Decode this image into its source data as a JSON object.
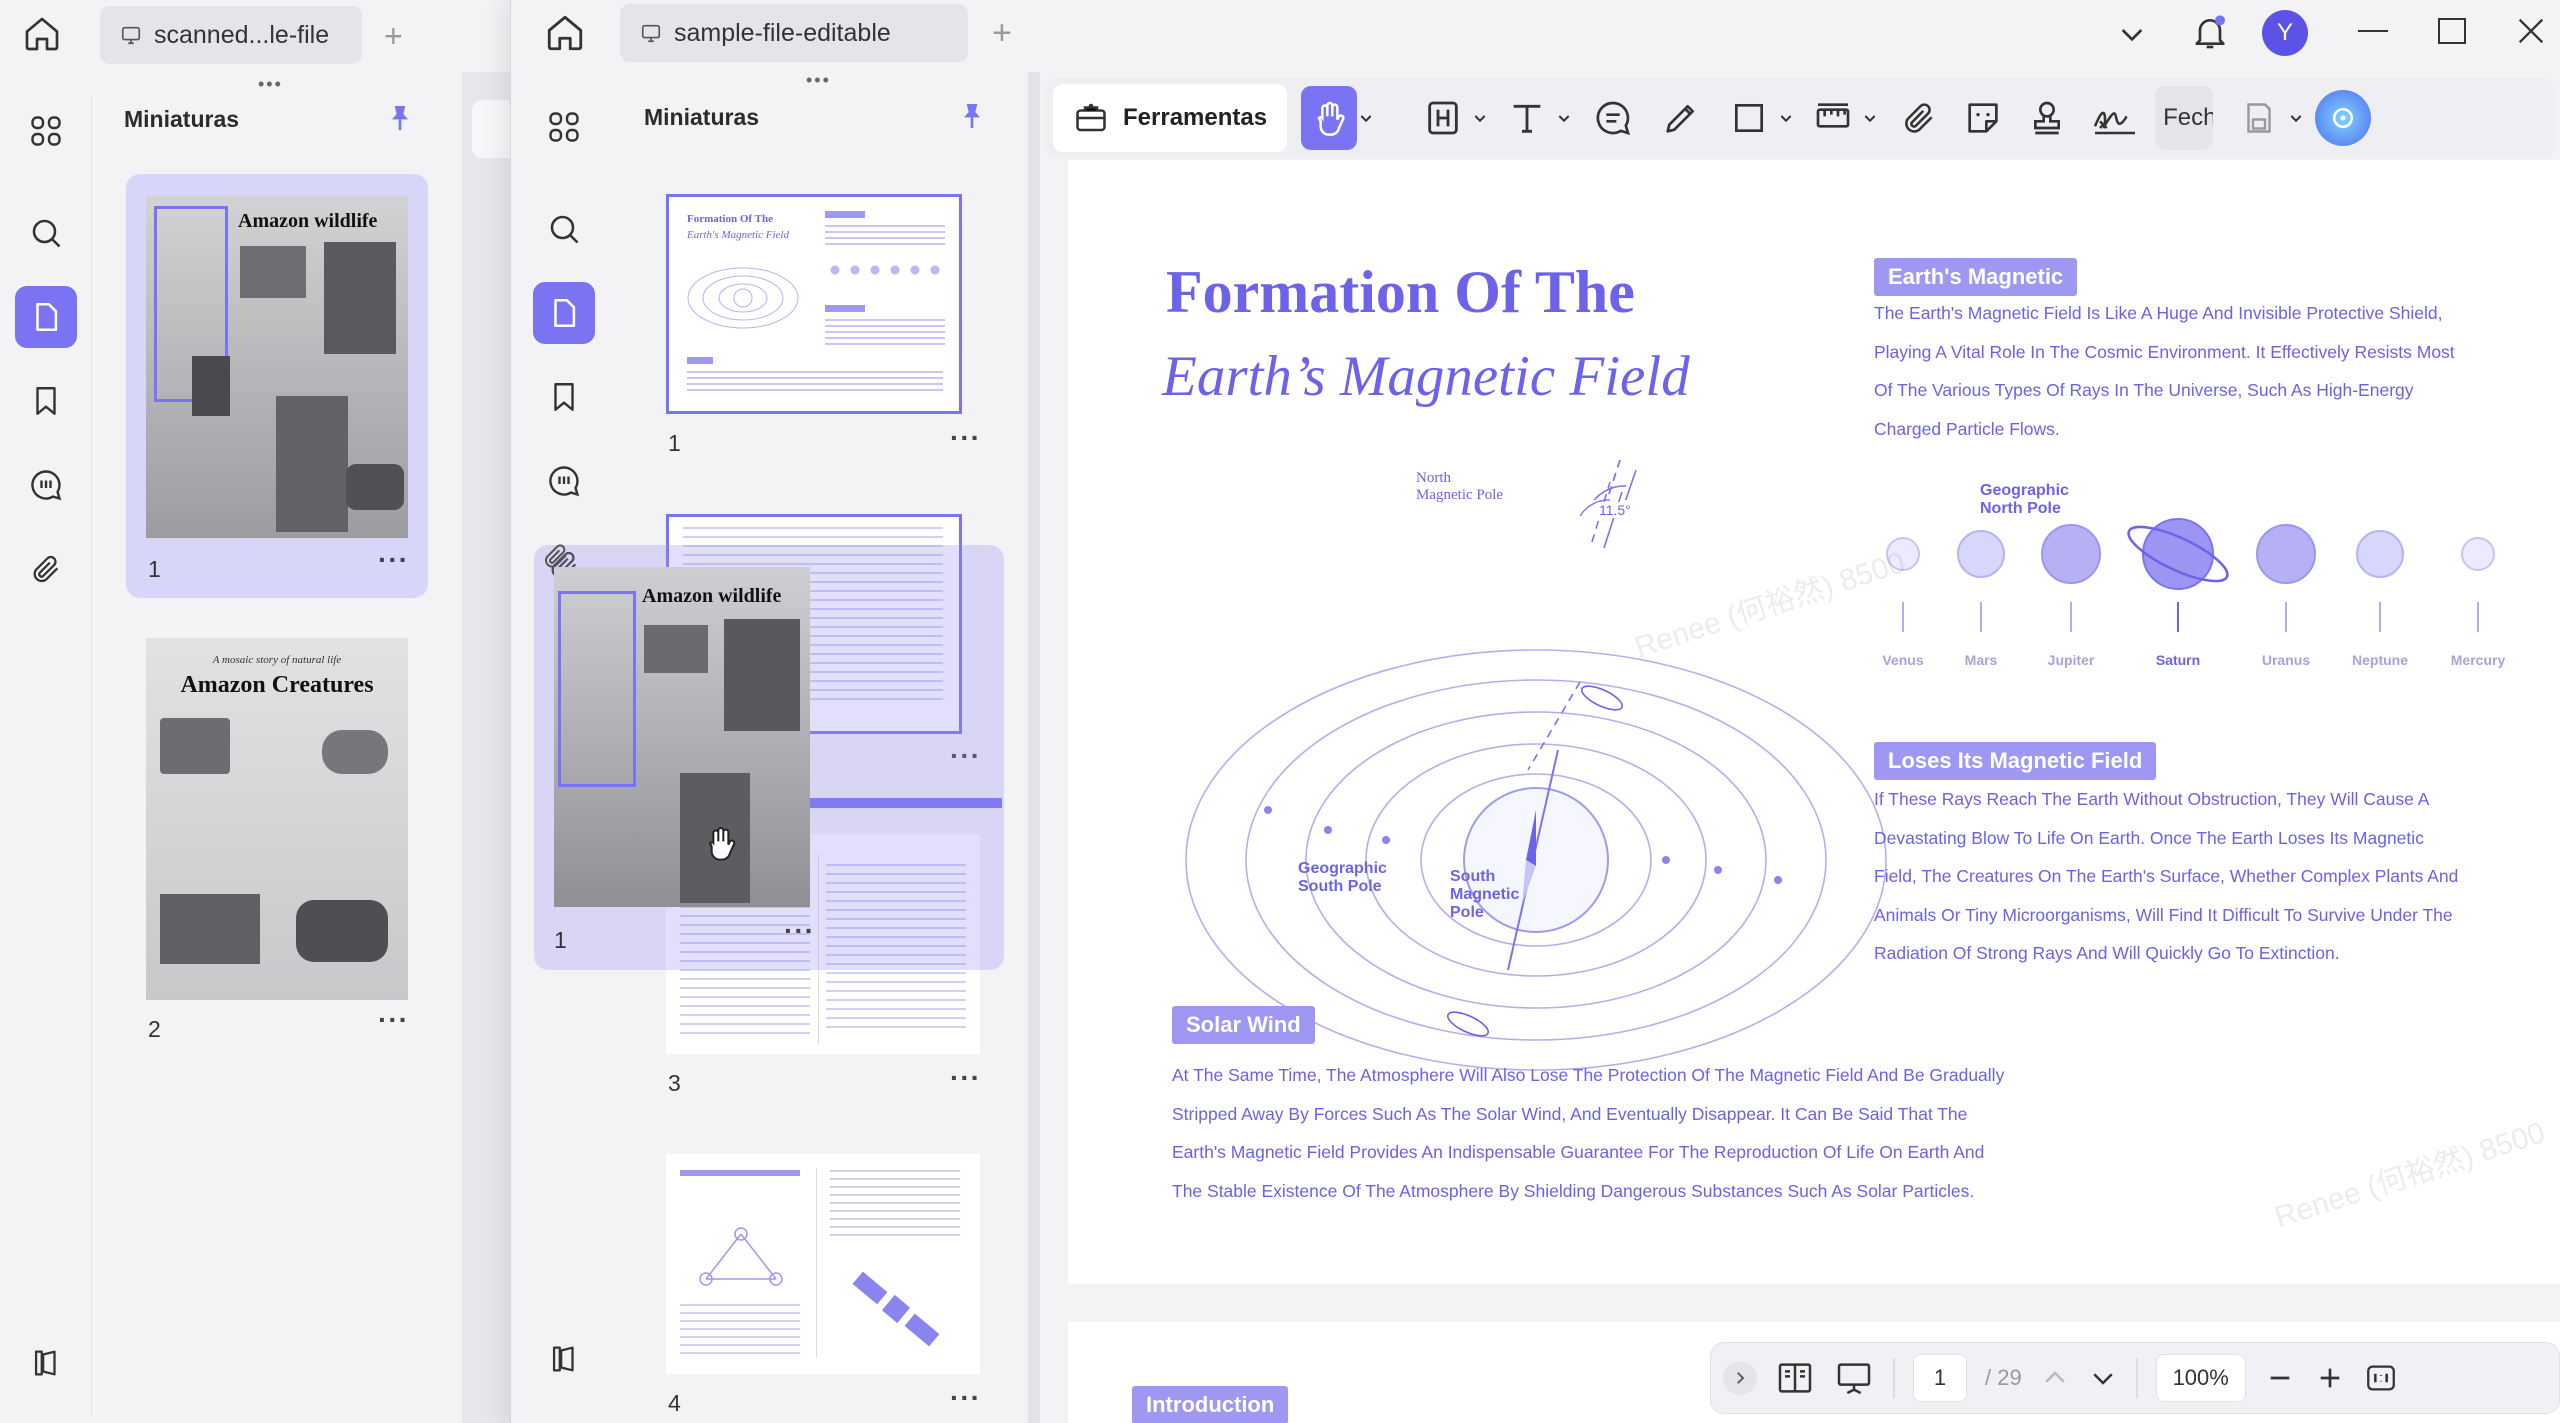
{
  "back_window": {
    "tab_title": "scanned...le-file",
    "panel_title": "Miniaturas",
    "thumbnails": [
      {
        "page": "1",
        "heading": "Amazon wildlife"
      },
      {
        "page": "2",
        "heading": "Amazon Creatures",
        "kicker": "A mosaic story of natural life"
      }
    ]
  },
  "front_window": {
    "tab_title": "sample-file-editable",
    "panel_title": "Miniaturas",
    "avatar_letter": "Y",
    "thumbnails": [
      {
        "page": "1",
        "title_line1": "Formation Of The",
        "title_line2": "Earth's Magnetic Field"
      },
      {
        "page": "3"
      },
      {
        "page": "4"
      }
    ],
    "drag_ghost": {
      "page": "1",
      "heading": "Amazon wildlife"
    }
  },
  "toolbar": {
    "tools_label": "Ferramentas",
    "truncated_label": "Fech"
  },
  "document": {
    "title_line1": "Formation Of The",
    "title_line2": "Earth’s Magnetic Field",
    "section_earth": {
      "heading": "Earth's Magnetic",
      "lines": [
        "The Earth's Magnetic Field Is Like A Huge And Invisible Protective Shield,",
        "Playing A Vital Role In The Cosmic Environment. It Effectively Resists Most",
        "Of The Various Types Of Rays In The Universe, Such As High-Energy",
        "Charged Particle Flows."
      ]
    },
    "planets": [
      "Venus",
      "Mars",
      "Jupiter",
      "Saturn",
      "Uranus",
      "Neptune",
      "Mercury"
    ],
    "diagram_labels": {
      "north_magnetic": [
        "North",
        "Magnetic Pole"
      ],
      "geo_north": [
        "Geographic",
        "North Pole"
      ],
      "angle": "11.5°",
      "geo_south": [
        "Geographic",
        "South Pole"
      ],
      "south_magnetic": [
        "South",
        "Magnetic",
        "Pole"
      ]
    },
    "section_loses": {
      "heading": "Loses Its Magnetic Field",
      "lines": [
        "If These Rays Reach The Earth Without Obstruction, They Will Cause A",
        "Devastating Blow To Life On Earth. Once The Earth Loses Its Magnetic",
        "Field, The Creatures On The Earth's Surface, Whether Complex Plants And",
        "Animals Or Tiny Microorganisms, Will Find It Difficult To Survive Under The",
        "Radiation Of Strong Rays And Will Quickly Go To Extinction."
      ]
    },
    "section_solar": {
      "heading": "Solar Wind",
      "lines": [
        "At The Same Time, The Atmosphere Will Also Lose The Protection Of The Magnetic Field And Be Gradually",
        "Stripped Away By Forces Such As The Solar Wind, And Eventually Disappear. It Can Be Said That The",
        "Earth's Magnetic Field Provides An Indispensable Guarantee For The Reproduction Of Life On Earth And",
        "The Stable Existence Of The Atmosphere By Shielding Dangerous Substances Such As Solar Particles."
      ]
    },
    "next_page_heading": "Introduction",
    "watermark": "Renee (何裕然) 8500"
  },
  "statusbar": {
    "current_page": "1",
    "total_pages": "/ 29",
    "zoom": "100%"
  },
  "colors": {
    "accent": "#7b74f2",
    "doc_text": "#6963e8",
    "pill": "#9e98f2"
  }
}
